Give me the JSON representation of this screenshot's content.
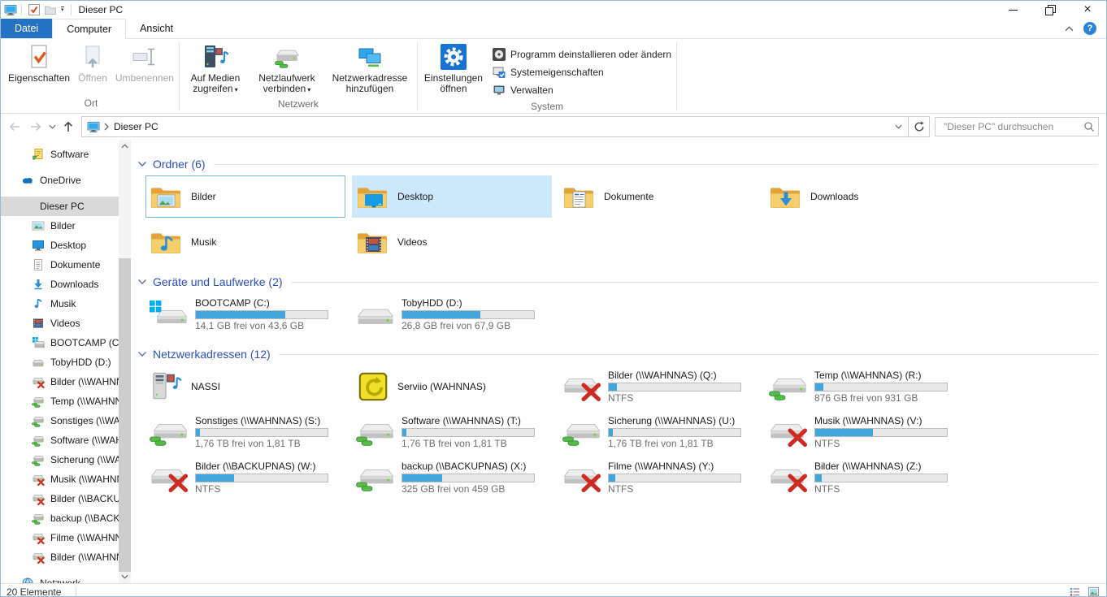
{
  "colors": {
    "file_tab_blue": "#2673c5",
    "selection_fill": "#cce8fa",
    "focus_border": "#7ab8e8",
    "bar_fill": "#42a5dc",
    "section_header_blue": "#2b4fc1",
    "sidebar_selected": "#d9d9d9",
    "windows_logo_blue": "#00adef"
  },
  "titlebar": {
    "title": "Dieser PC",
    "qat_icons": [
      "this-pc-icon",
      "properties-check-icon",
      "new-folder-icon",
      "customize-quick-access-dropdown"
    ]
  },
  "tabs": [
    {
      "label": "Datei"
    },
    {
      "label": "Computer"
    },
    {
      "label": "Ansicht"
    }
  ],
  "ribbon": {
    "ort": {
      "label": "Ort",
      "buttons": [
        {
          "label": "Eigenschaften"
        },
        {
          "label": "Öffnen"
        },
        {
          "label": "Umbenennen"
        }
      ]
    },
    "netzwerk": {
      "label": "Netzwerk",
      "buttons": [
        {
          "label": "Auf Medien zugreifen"
        },
        {
          "label": "Netzlaufwerk verbinden"
        },
        {
          "label": "Netzwerkadresse hinzufügen"
        }
      ]
    },
    "system": {
      "label": "System",
      "big_button": "Einstellungen öffnen",
      "small_buttons": [
        "Programm deinstallieren oder ändern",
        "Systemeigenschaften",
        "Verwalten"
      ]
    }
  },
  "navbar": {
    "breadcrumb_root": "Dieser PC",
    "search_placeholder": "\"Dieser PC\" durchsuchen"
  },
  "sidebar": {
    "items": [
      {
        "label": "Software",
        "icon": "shortcut",
        "indent": 1
      },
      {
        "label": "OneDrive",
        "icon": "onedrive",
        "indent": 0,
        "gap": true
      },
      {
        "label": "Dieser PC",
        "icon": "pc",
        "indent": 0,
        "gap": true,
        "selected": true
      },
      {
        "label": "Bilder",
        "icon": "pictures",
        "indent": 1
      },
      {
        "label": "Desktop",
        "icon": "desktop",
        "indent": 1
      },
      {
        "label": "Dokumente",
        "icon": "documents",
        "indent": 1
      },
      {
        "label": "Downloads",
        "icon": "downloads",
        "indent": 1
      },
      {
        "label": "Musik",
        "icon": "music",
        "indent": 1
      },
      {
        "label": "Videos",
        "icon": "videos",
        "indent": 1
      },
      {
        "label": "BOOTCAMP (C:)",
        "icon": "drive-windows",
        "indent": 1
      },
      {
        "label": "TobyHDD (D:)",
        "icon": "drive",
        "indent": 1
      },
      {
        "label": "Bilder (\\\\WAHNNAS) (Q:)",
        "icon": "netdrive-off",
        "indent": 1
      },
      {
        "label": "Temp (\\\\WAHNNAS) (R:)",
        "icon": "netdrive",
        "indent": 1
      },
      {
        "label": "Sonstiges (\\\\WAHNNAS) (S:)",
        "icon": "netdrive",
        "indent": 1
      },
      {
        "label": "Software (\\\\WAHNNAS) (T:)",
        "icon": "netdrive",
        "indent": 1
      },
      {
        "label": "Sicherung (\\\\WAHNNAS) (U:)",
        "icon": "netdrive",
        "indent": 1
      },
      {
        "label": "Musik (\\\\WAHNNAS) (V:)",
        "icon": "netdrive-off",
        "indent": 1
      },
      {
        "label": "Bilder (\\\\BACKUPNAS) (W:)",
        "icon": "netdrive-off",
        "indent": 1
      },
      {
        "label": "backup (\\\\BACKUPNAS) (X:)",
        "icon": "netdrive",
        "indent": 1
      },
      {
        "label": "Filme (\\\\WAHNNAS) (Y:)",
        "icon": "netdrive-off",
        "indent": 1
      },
      {
        "label": "Bilder (\\\\WAHNNAS) (Z:)",
        "icon": "netdrive-off",
        "indent": 1
      },
      {
        "label": "Netzwerk",
        "icon": "network",
        "indent": 0,
        "gap": true
      }
    ]
  },
  "content": {
    "sections": [
      {
        "title": "Ordner (6)",
        "items": [
          {
            "label": "Bilder",
            "icon": "folder-pictures",
            "state": "focused"
          },
          {
            "label": "Desktop",
            "icon": "folder-desktop",
            "state": "selected"
          },
          {
            "label": "Dokumente",
            "icon": "folder-documents"
          },
          {
            "label": "Downloads",
            "icon": "folder-downloads"
          },
          {
            "label": "Musik",
            "icon": "folder-music"
          },
          {
            "label": "Videos",
            "icon": "folder-videos"
          }
        ]
      },
      {
        "title": "Geräte und Laufwerke (2)",
        "items": [
          {
            "label": "BOOTCAMP (C:)",
            "icon": "drive-windows-big",
            "info": "14,1 GB frei von 43,6 GB",
            "fill": 68
          },
          {
            "label": "TobyHDD (D:)",
            "icon": "drive-big",
            "info": "26,8 GB frei von 67,9 GB",
            "fill": 59
          }
        ]
      },
      {
        "title": "Netzwerkadressen (12)",
        "items": [
          {
            "label": "NASSI",
            "icon": "media-server"
          },
          {
            "label": "Serviio (WAHNNAS)",
            "icon": "serviio"
          },
          {
            "label": "Bilder (\\\\WAHNNAS) (Q:)",
            "icon": "netdrive-off-big",
            "info": "NTFS",
            "fill": 6
          },
          {
            "label": "Temp (\\\\WAHNNAS) (R:)",
            "icon": "netdrive-big",
            "info": "876 GB frei von 931 GB",
            "fill": 6
          },
          {
            "label": "Sonstiges (\\\\WAHNNAS) (S:)",
            "icon": "netdrive-big",
            "info": "1,76 TB frei von 1,81 TB",
            "fill": 3
          },
          {
            "label": "Software (\\\\WAHNNAS) (T:)",
            "icon": "netdrive-big",
            "info": "1,76 TB frei von 1,81 TB",
            "fill": 3
          },
          {
            "label": "Sicherung (\\\\WAHNNAS) (U:)",
            "icon": "netdrive-big",
            "info": "1,76 TB frei von 1,81 TB",
            "fill": 3
          },
          {
            "label": "Musik (\\\\WAHNNAS) (V:)",
            "icon": "netdrive-off-big",
            "info": "NTFS",
            "fill": 44
          },
          {
            "label": "Bilder (\\\\BACKUPNAS) (W:)",
            "icon": "netdrive-off-big",
            "info": "NTFS",
            "fill": 29
          },
          {
            "label": "backup (\\\\BACKUPNAS) (X:)",
            "icon": "netdrive-big",
            "info": "325 GB frei von 459 GB",
            "fill": 30
          },
          {
            "label": "Filme (\\\\WAHNNAS) (Y:)",
            "icon": "netdrive-off-big",
            "info": "NTFS",
            "fill": 5
          },
          {
            "label": "Bilder (\\\\WAHNNAS) (Z:)",
            "icon": "netdrive-off-big",
            "info": "NTFS",
            "fill": 5
          }
        ]
      }
    ]
  },
  "statusbar": {
    "count": "20 Elemente"
  }
}
